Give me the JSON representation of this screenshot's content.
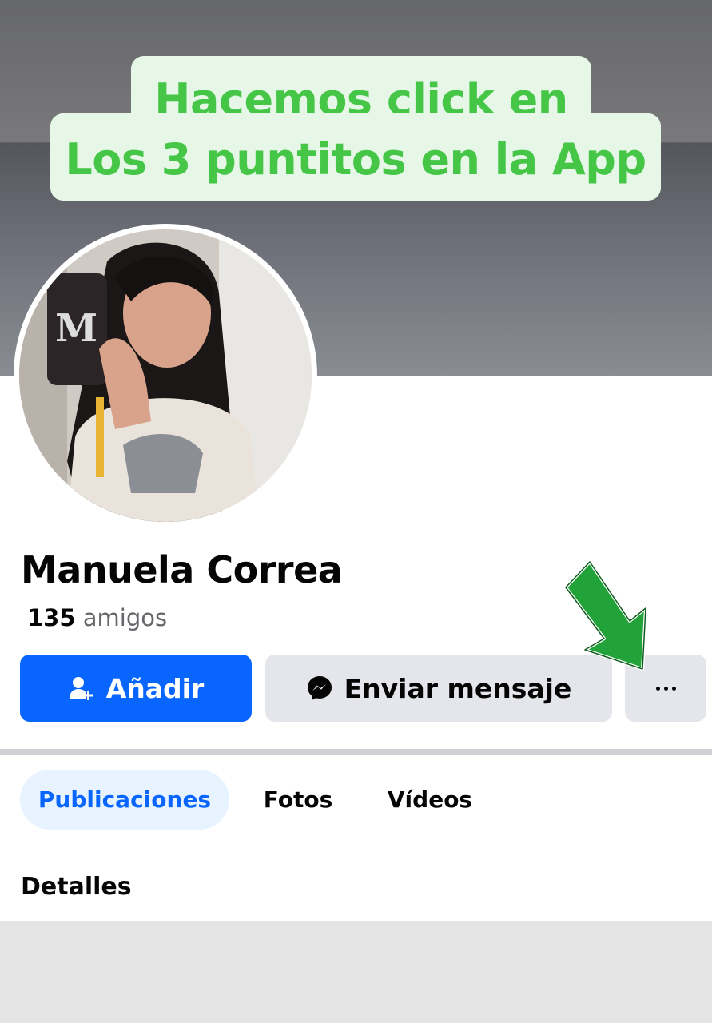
{
  "tutorial": {
    "line1": "Hacemos click en",
    "line2": "Los 3 puntitos en la App",
    "text_color": "#45c646",
    "background_color": "#e6f7e7",
    "arrow_color": "#22a33a"
  },
  "profile": {
    "name": "Manuela Correa",
    "friends_count": "135",
    "friends_label": "amigos"
  },
  "actions": {
    "add_label": "Añadir",
    "message_label": "Enviar mensaje",
    "more_label": "···",
    "primary_color": "#0866ff"
  },
  "tabs": [
    {
      "label": "Publicaciones",
      "active": true
    },
    {
      "label": "Fotos",
      "active": false
    },
    {
      "label": "Vídeos",
      "active": false
    }
  ],
  "details": {
    "title": "Detalles"
  },
  "icons": {
    "add": "add-friend-icon",
    "message": "messenger-icon",
    "more": "more-dots-icon",
    "pointer": "green-arrow-icon"
  }
}
